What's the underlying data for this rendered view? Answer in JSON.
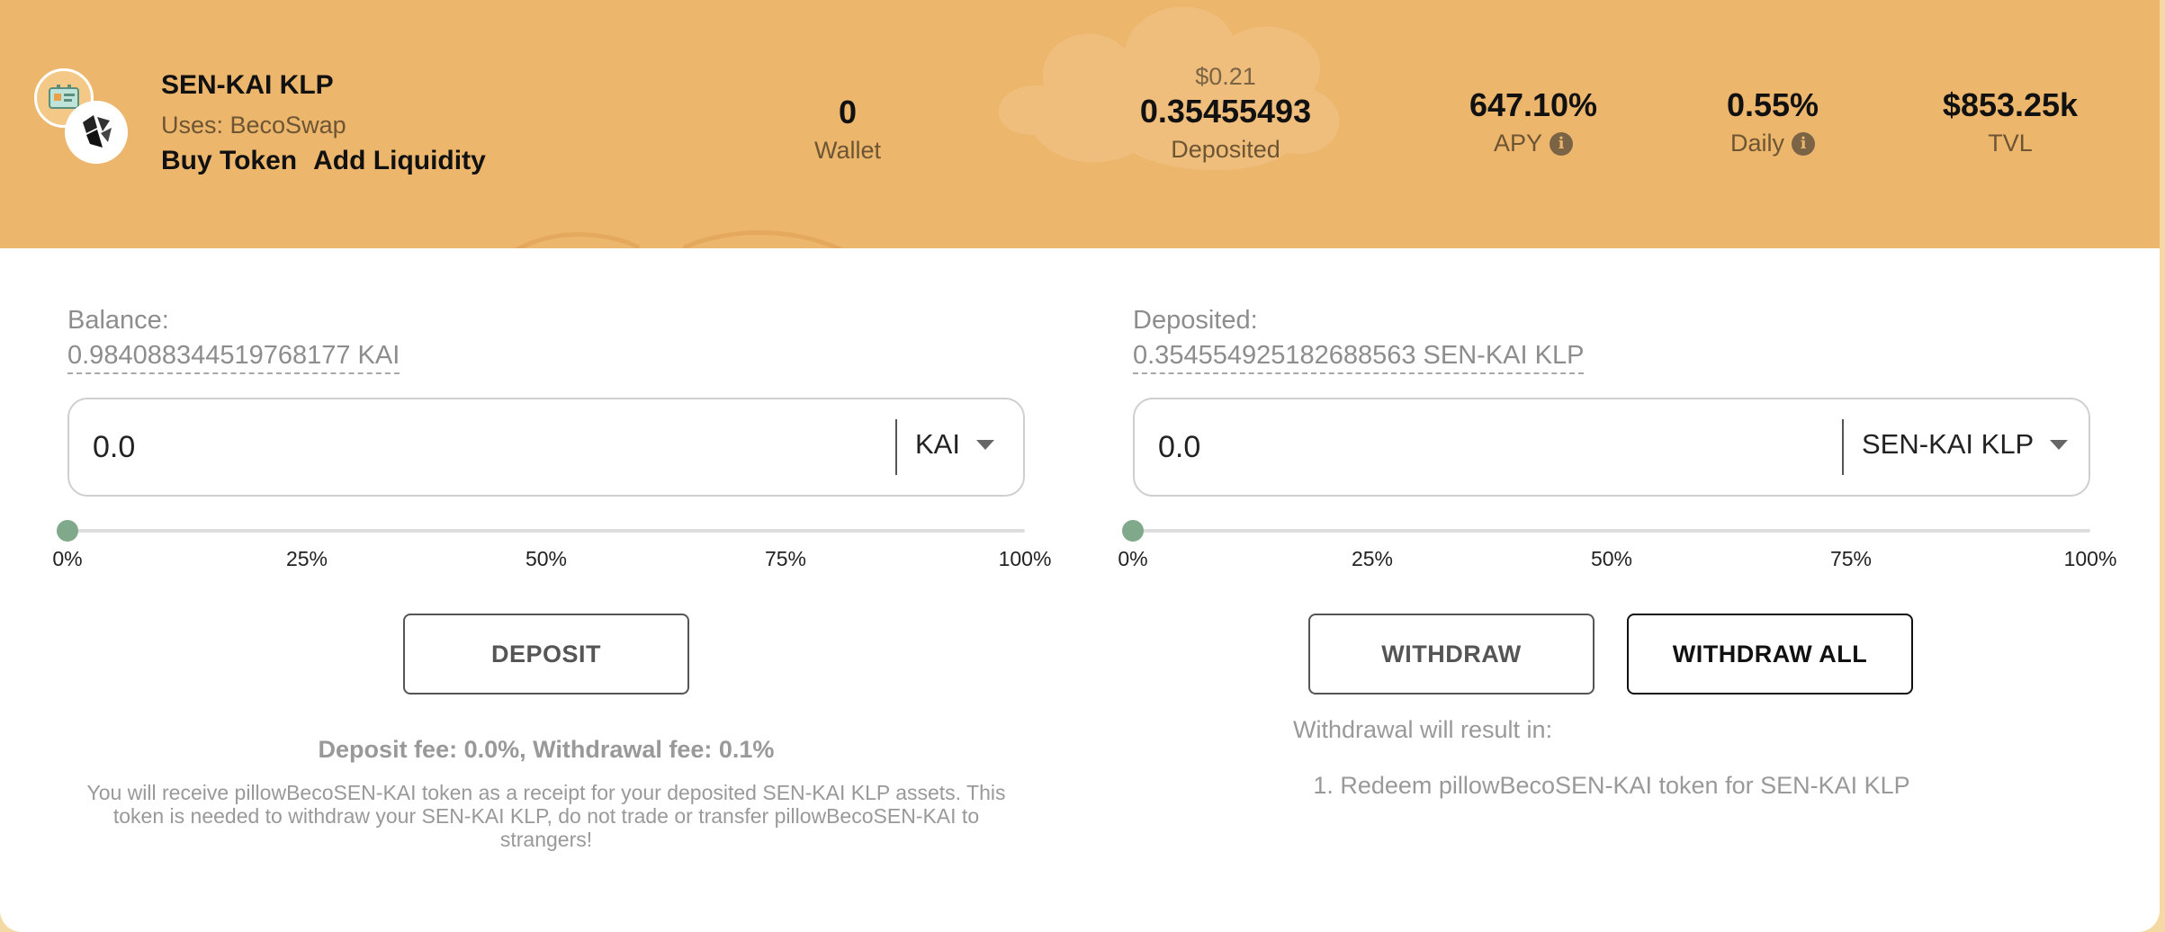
{
  "header": {
    "pool_name": "SEN-KAI KLP",
    "uses": "Uses: BecoSwap",
    "links": {
      "buy_token": "Buy Token",
      "add_liquidity": "Add Liquidity"
    },
    "stats": {
      "wallet": {
        "value": "0",
        "label": "Wallet"
      },
      "deposited": {
        "price": "$0.21",
        "value": "0.35455493",
        "label": "Deposited"
      },
      "apy": {
        "value": "647.10%",
        "label": "APY"
      },
      "daily": {
        "value": "0.55%",
        "label": "Daily"
      },
      "tvl": {
        "value": "$853.25k",
        "label": "TVL"
      }
    }
  },
  "deposit_panel": {
    "balance_label": "Balance:",
    "balance_value": "0.984088344519768177 KAI",
    "amount": "0.0",
    "token": "KAI",
    "slider_value": 0,
    "ticks": [
      "0%",
      "25%",
      "50%",
      "75%",
      "100%"
    ],
    "button": "DEPOSIT",
    "fee": "Deposit fee: 0.0%, Withdrawal fee: 0.1%",
    "notice": "You will receive pillowBecoSEN-KAI token as a receipt for your deposited SEN-KAI KLP assets. This token is needed to withdraw your SEN-KAI KLP, do not trade or transfer pillowBecoSEN-KAI to strangers!"
  },
  "withdraw_panel": {
    "deposited_label": "Deposited:",
    "deposited_value": "0.354554925182688563 SEN-KAI KLP",
    "amount": "0.0",
    "token": "SEN-KAI KLP",
    "slider_value": 0,
    "ticks": [
      "0%",
      "25%",
      "50%",
      "75%",
      "100%"
    ],
    "withdraw_button": "WITHDRAW",
    "withdraw_all_button": "WITHDRAW ALL",
    "result_title": "Withdrawal will result in:",
    "result_item": "1. Redeem pillowBecoSEN-KAI token for SEN-KAI KLP"
  },
  "colors": {
    "header": "#edb66d",
    "slider_thumb": "#7fa98a",
    "page_bg": "#f4d9a4"
  }
}
